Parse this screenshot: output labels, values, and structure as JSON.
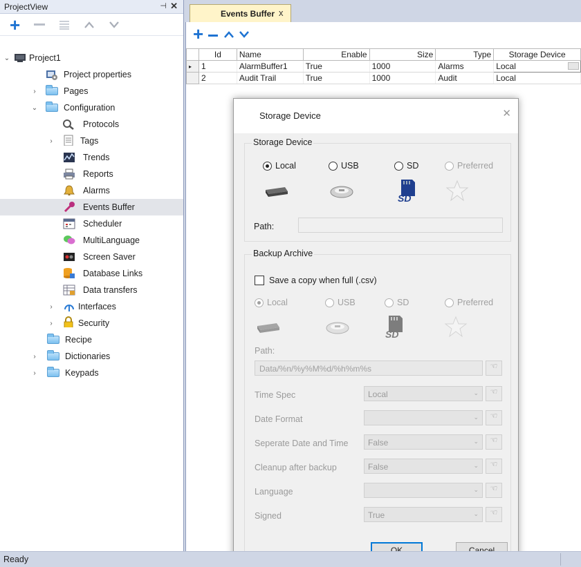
{
  "left_panel": {
    "title": "ProjectView",
    "pin": "⊣",
    "close": "✕",
    "tree": [
      {
        "label": "Project1",
        "level": 0,
        "expanded": true,
        "icon": "computer-icon"
      },
      {
        "label": "Project properties",
        "level": 1,
        "icon": "project-properties-icon"
      },
      {
        "label": "Pages",
        "level": 1,
        "expander": "collapsed",
        "icon": "folder-icon"
      },
      {
        "label": "Configuration",
        "level": 1,
        "expander": "expanded",
        "icon": "folder-icon"
      },
      {
        "label": "Protocols",
        "level": 2,
        "icon": "protocols-icon"
      },
      {
        "label": "Tags",
        "level": 2,
        "expander": "collapsed",
        "icon": "tags-icon"
      },
      {
        "label": "Trends",
        "level": 2,
        "icon": "trends-icon"
      },
      {
        "label": "Reports",
        "level": 2,
        "icon": "printer-icon"
      },
      {
        "label": "Alarms",
        "level": 2,
        "icon": "bell-icon"
      },
      {
        "label": "Events Buffer",
        "level": 2,
        "icon": "events-buffer-icon",
        "selected": true
      },
      {
        "label": "Scheduler",
        "level": 2,
        "icon": "calendar-icon"
      },
      {
        "label": "MultiLanguage",
        "level": 2,
        "icon": "speech-bubble-icon"
      },
      {
        "label": "Screen Saver",
        "level": 2,
        "icon": "screen-saver-icon"
      },
      {
        "label": "Database Links",
        "level": 2,
        "icon": "database-icon"
      },
      {
        "label": "Data transfers",
        "level": 2,
        "icon": "data-transfer-icon"
      },
      {
        "label": "Interfaces",
        "level": 1,
        "expander": "collapsed",
        "icon": "interfaces-icon"
      },
      {
        "label": "Security",
        "level": 1,
        "expander": "collapsed",
        "icon": "lock-icon"
      },
      {
        "label": "Recipe",
        "level": 1,
        "icon": "folder-icon"
      },
      {
        "label": "Dictionaries",
        "level": 1,
        "expander": "collapsed",
        "icon": "folder-icon"
      },
      {
        "label": "Keypads",
        "level": 1,
        "expander": "collapsed",
        "icon": "folder-icon"
      }
    ]
  },
  "tab": {
    "label": "Events Buffer",
    "close": "x"
  },
  "table": {
    "columns": [
      "Id",
      "Name",
      "Enable",
      "Size",
      "Type",
      "Storage Device"
    ],
    "rows": [
      [
        "1",
        "AlarmBuffer1",
        "True",
        "1000",
        "Alarms",
        "Local"
      ],
      [
        "2",
        "Audit Trail",
        "True",
        "1000",
        "Audit",
        "Local"
      ]
    ]
  },
  "dialog": {
    "title": "Storage Device",
    "close": "✕",
    "storage": {
      "group_label": "Storage Device",
      "options": [
        {
          "label": "Local",
          "checked": true
        },
        {
          "label": "USB",
          "checked": false
        },
        {
          "label": "SD",
          "checked": false
        },
        {
          "label": "Preferred",
          "checked": false,
          "disabled": true
        }
      ],
      "path_label": "Path:",
      "path_value": ""
    },
    "backup": {
      "group_label": "Backup Archive",
      "save_copy_label": "Save a copy when full (.csv)",
      "save_copy_checked": false,
      "options": [
        {
          "label": "Local",
          "checked": true
        },
        {
          "label": "USB",
          "checked": false
        },
        {
          "label": "SD",
          "checked": false
        },
        {
          "label": "Preferred",
          "checked": false
        }
      ],
      "path_label": "Path:",
      "path_value": "Data/%n/%y%M%d/%h%m%s",
      "props": [
        {
          "label": "Time Spec",
          "value": "Local"
        },
        {
          "label": "Date Format",
          "value": ""
        },
        {
          "label": "Seperate Date and Time",
          "value": "False"
        },
        {
          "label": "Cleanup after backup",
          "value": "False"
        },
        {
          "label": "Language",
          "value": ""
        },
        {
          "label": "Signed",
          "value": "True"
        }
      ]
    },
    "ok_label": "OK",
    "cancel_label": "Cancel"
  },
  "status": {
    "text": "Ready"
  },
  "colors": {
    "accent": "#1e73d2",
    "tab": "#fff4c9",
    "chrome": "#cfd6e5",
    "selection": "#e2e4e9"
  }
}
